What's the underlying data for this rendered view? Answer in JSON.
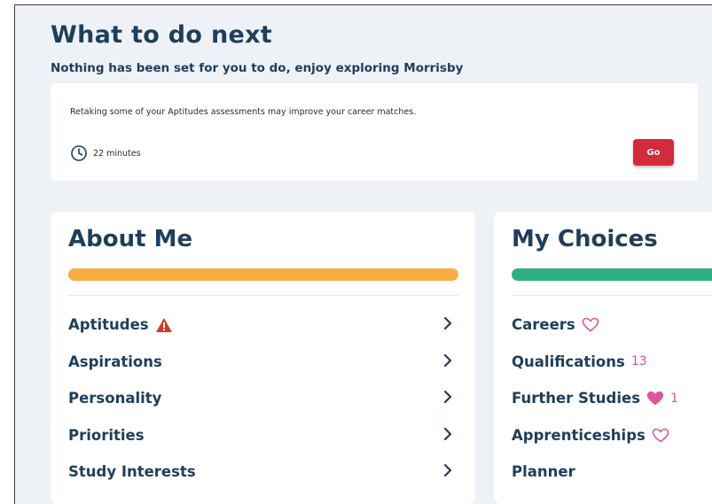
{
  "next": {
    "title": "What to do next",
    "subtitle": "Nothing has been set for you to do, enjoy exploring Morrisby",
    "task": {
      "text": "Retaking some of your Aptitudes  assessments may improve your career matches.",
      "duration": "22 minutes",
      "go_label": "Go"
    }
  },
  "about": {
    "title": "About Me",
    "bar_color": "#f8ad43",
    "items": [
      {
        "label": "Aptitudes",
        "icon": "warning-icon"
      },
      {
        "label": "Aspirations"
      },
      {
        "label": "Personality"
      },
      {
        "label": "Priorities"
      },
      {
        "label": "Study Interests"
      }
    ]
  },
  "choices": {
    "title": "My Choices",
    "bar_color": "#2eae83",
    "items": [
      {
        "label": "Careers",
        "icon": "heart-outline-icon"
      },
      {
        "label": "Qualifications",
        "count": "13"
      },
      {
        "label": "Further Studies",
        "icon": "heart-filled-icon",
        "count": "1"
      },
      {
        "label": "Apprenticeships",
        "icon": "heart-outline-icon"
      },
      {
        "label": "Planner"
      }
    ]
  },
  "colors": {
    "heading": "#1d3f5c",
    "go_button": "#d42a3d",
    "warning": "#d33b26",
    "heart": "#e0559a",
    "background": "#eef2f6"
  }
}
